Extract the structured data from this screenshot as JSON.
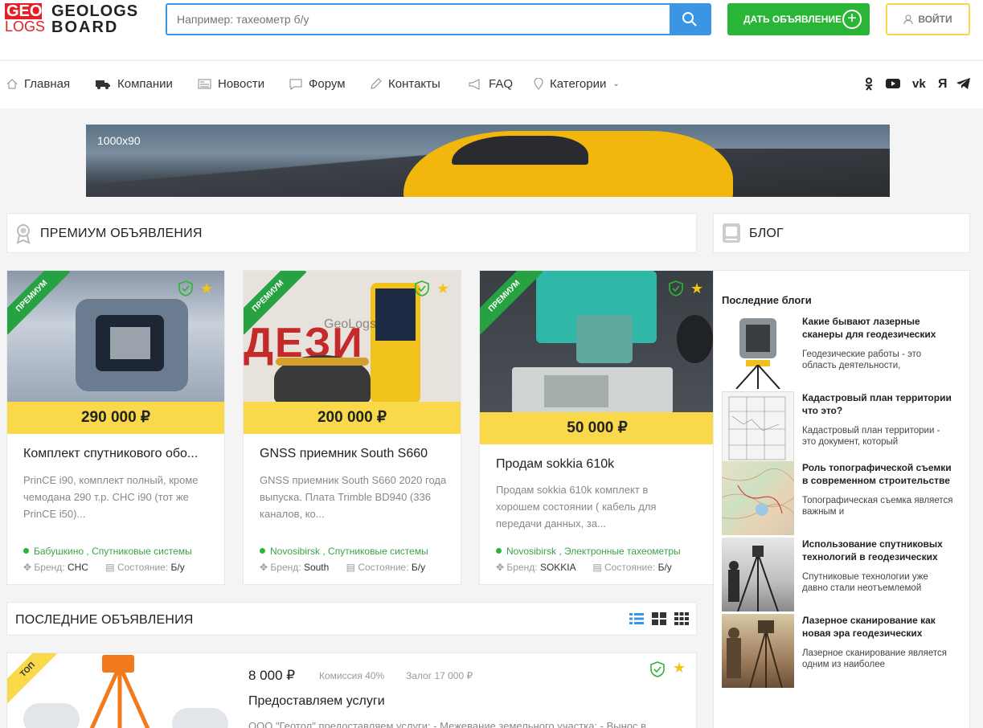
{
  "header": {
    "logo_geo": "GEO",
    "logo_logs": "LOGS",
    "brand_line1": "GEOLOGS",
    "brand_line2": "BOARD",
    "search_placeholder": "Например: тахеометр б/у",
    "add_label": "ДАТЬ ОБЪЯВЛЕНИЕ",
    "login_label": "ВОЙТИ"
  },
  "nav": {
    "items": [
      {
        "label": "Главная",
        "icon": "home-icon"
      },
      {
        "label": "Компании",
        "icon": "truck-icon"
      },
      {
        "label": "Новости",
        "icon": "newspaper-icon"
      },
      {
        "label": "Форум",
        "icon": "chat-icon"
      },
      {
        "label": "Контакты",
        "icon": "pencil-icon"
      },
      {
        "label": "FAQ",
        "icon": "megaphone-icon"
      },
      {
        "label": "Категории",
        "icon": "map-pin-icon"
      }
    ],
    "social": [
      "ok-icon",
      "youtube-icon",
      "vk-icon",
      "yandex-icon",
      "telegram-icon"
    ]
  },
  "banner": {
    "label": "1000x90"
  },
  "premium": {
    "title": "ПРЕМИУМ ОБЪЯВЛЕНИЯ",
    "ribbon": "ПРЕМИУМ",
    "brand_label": "Бренд:",
    "state_label": "Состояние:",
    "cards": [
      {
        "price": "290 000 ₽",
        "title": "Комплект спутникового обо...",
        "desc": "PrinCE i90, комплект полный, кроме чемодана 290 т.р. CHC i90 (тот же PrinCE i50)...",
        "city": "Бабушкино",
        "category": "Спутниковые системы",
        "brand": "CHC",
        "state": "Б/у"
      },
      {
        "price": "200 000 ₽",
        "title": "GNSS приемник South S660",
        "desc": "GNSS приемник South S660 2020 года выпуска. Плата Trimble BD940 (336 каналов, ко...",
        "city": "Novosibirsk",
        "category": "Спутниковые системы",
        "brand": "South",
        "state": "Б/у",
        "watermark": "GeoLogs"
      },
      {
        "price": "50 000 ₽",
        "title": "Продам sokkia 610k",
        "desc": "Продам sokkia 610k комплект в хорошем состоянии ( кабель для передачи данных, за...",
        "city": "Novosibirsk",
        "category": "Электронные тахеометры",
        "brand": "SOKKIA",
        "state": "Б/у"
      }
    ]
  },
  "latest": {
    "title": "ПОСЛЕДНИЕ ОБЪЯВЛЕНИЯ",
    "views": [
      "list-view-icon",
      "grid-view-icon",
      "small-grid-view-icon"
    ],
    "item": {
      "ribbon": "ТОП",
      "price": "8 000 ₽",
      "commission": "Комиссия 40%",
      "deposit": "Залог 17 000 ₽",
      "title": "Предоставляем услуги",
      "desc": "ООО \"Геотол\" предоставляем услуги: - Межевание земельного участка; - Вынос в"
    }
  },
  "blog": {
    "title": "БЛОГ",
    "subtitle": "Последние блоги",
    "items": [
      {
        "title": "Какие бывают лазерные сканеры для геодезических работ",
        "desc": "Геодезические работы - это область деятельности,"
      },
      {
        "title": "Кадастровый план территории что это?",
        "desc": "Кадастровый план территории - это документ, который"
      },
      {
        "title": "Роль топографической съемки в современном строительстве",
        "desc": "Топографическая съемка является важным и"
      },
      {
        "title": "Использование спутниковых технологий в геодезических работах: революция в",
        "desc": "Спутниковые технологии уже давно стали неотъемлемой"
      },
      {
        "title": "Лазерное сканирование как новая эра геодезических изысканий",
        "desc": "Лазерное сканирование является одним из наиболее"
      }
    ]
  }
}
